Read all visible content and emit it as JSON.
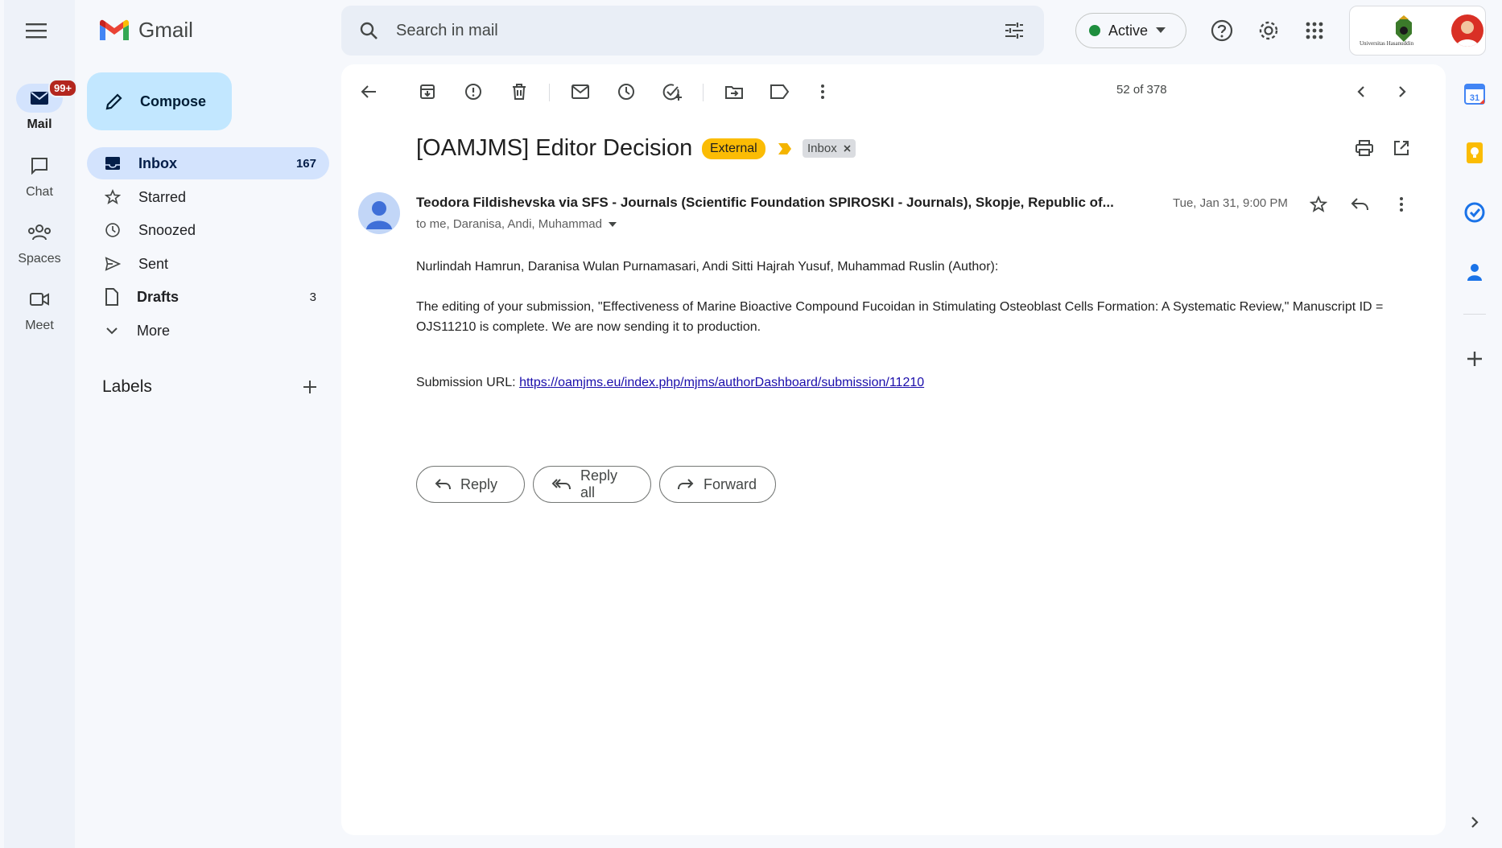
{
  "app": {
    "name": "Gmail"
  },
  "rail": {
    "mail_label": "Mail",
    "mail_badge": "99+",
    "chat_label": "Chat",
    "spaces_label": "Spaces",
    "meet_label": "Meet"
  },
  "compose_label": "Compose",
  "nav": {
    "inbox": {
      "label": "Inbox",
      "count": "167"
    },
    "starred": {
      "label": "Starred"
    },
    "snoozed": {
      "label": "Snoozed"
    },
    "sent": {
      "label": "Sent"
    },
    "drafts": {
      "label": "Drafts",
      "count": "3"
    },
    "more": {
      "label": "More"
    }
  },
  "labels_heading": "Labels",
  "search": {
    "placeholder": "Search in mail"
  },
  "status": {
    "label": "Active",
    "color": "#1e8e3e"
  },
  "account": {
    "org_text": "Universitas Hasanuddin"
  },
  "pager": {
    "text": "52 of 378"
  },
  "email": {
    "subject": "[OAMJMS] Editor Decision",
    "chip_external": "External",
    "chip_inbox": "Inbox",
    "sender": "Teodora Fildishevska via SFS - Journals (Scientific Foundation SPIROSKI - Journals), Skopje, Republic of...",
    "recipients": "to me, Daranisa, Andi, Muhammad",
    "date": "Tue, Jan 31, 9:00 PM",
    "greeting": "Nurlindah Hamrun, Daranisa Wulan Purnamasari, Andi Sitti Hajrah Yusuf, Muhammad Ruslin (Author):",
    "paragraph": "The editing of your submission, \"Effectiveness of Marine Bioactive Compound Fucoidan in Stimulating Osteoblast Cells Formation: A Systematic Review,\" Manuscript ID = OJS11210 is complete. We are now sending it to production.",
    "url_label": "Submission URL:",
    "url": "https://oamjms.eu/index.php/mjms/authorDashboard/submission/11210"
  },
  "actions": {
    "reply": "Reply",
    "reply_all": "Reply all",
    "forward": "Forward"
  },
  "colors": {
    "accent": "#0b57d0",
    "active_nav": "#d3e3fd",
    "compose_bg": "#c2e7ff",
    "external_chip": "#fbbc04"
  },
  "icons": [
    "menu-icon",
    "gmail-logo",
    "search-icon",
    "filter-icon",
    "help-icon",
    "settings-icon",
    "apps-icon",
    "back-icon",
    "archive-icon",
    "report-icon",
    "delete-icon",
    "mark-unread-icon",
    "snooze-icon",
    "add-task-icon",
    "move-icon",
    "label-icon",
    "more-icon",
    "print-icon",
    "open-new-window-icon",
    "star-icon",
    "reply-icon",
    "calendar-icon",
    "keep-icon",
    "tasks-icon",
    "contacts-icon",
    "add-icon"
  ]
}
